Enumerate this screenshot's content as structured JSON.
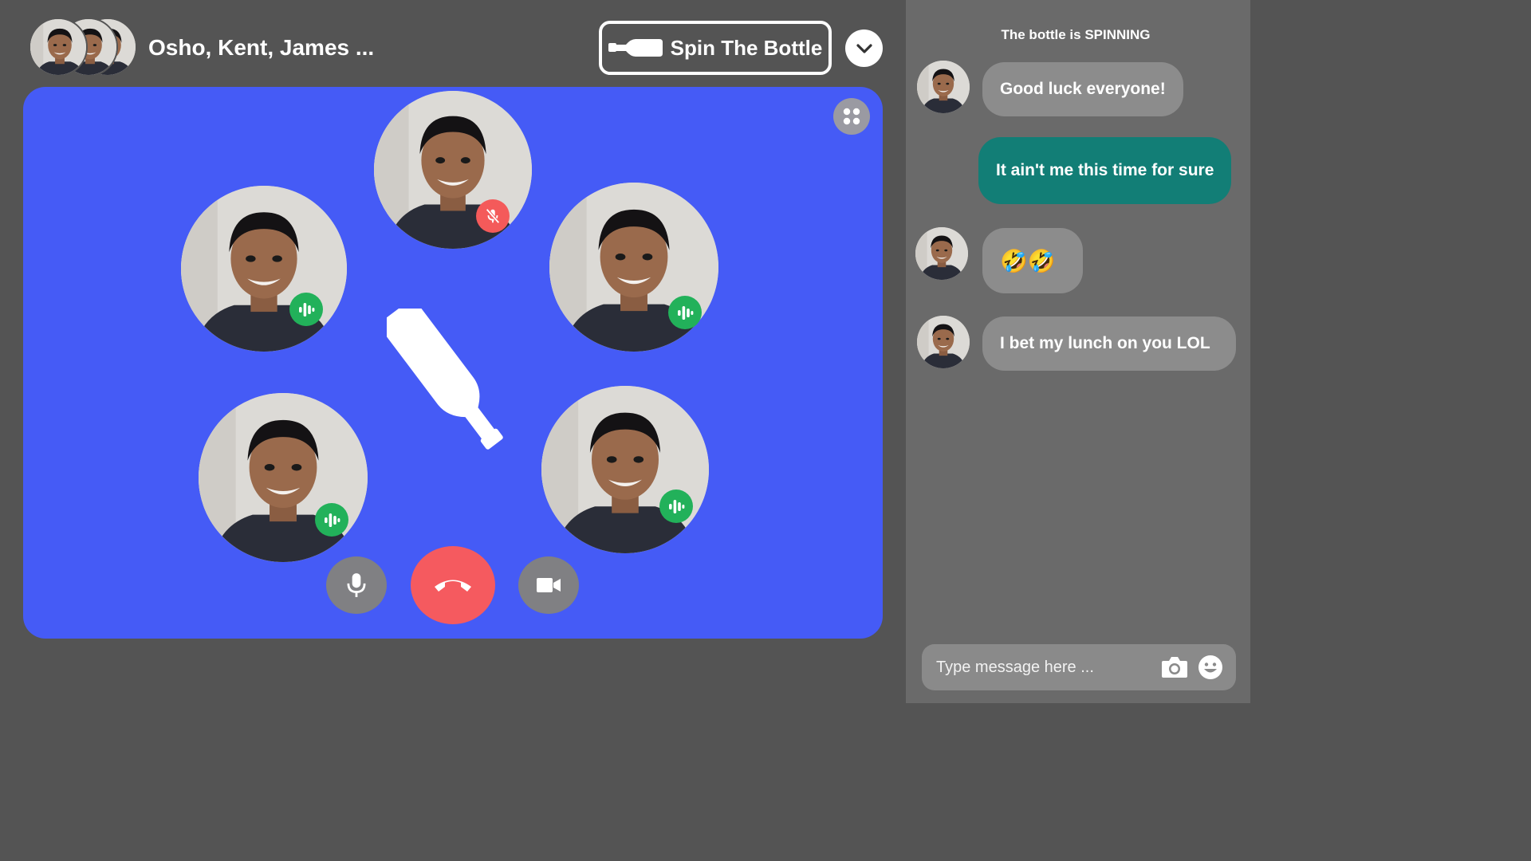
{
  "header": {
    "group_title": "Osho, Kent, James ...",
    "spin_button_label": "Spin The Bottle",
    "avatars": [
      "avatar",
      "avatar",
      "avatar"
    ]
  },
  "stage": {
    "background_color": "#455bf6",
    "participants": [
      {
        "status": "muted"
      },
      {
        "status": "talking"
      },
      {
        "status": "talking"
      },
      {
        "status": "talking"
      },
      {
        "status": "talking"
      }
    ],
    "controls": [
      "mic-icon",
      "end-call-icon",
      "video-camera-icon"
    ],
    "accent": {
      "talking": "#22b15a",
      "muted": "#f45a5a",
      "end_call": "#f55a5f"
    }
  },
  "chat": {
    "status": "The bottle is SPINNING",
    "messages": [
      {
        "text": "Good luck everyone!",
        "mine": false
      },
      {
        "text": "It ain't me this time for sure",
        "mine": true
      },
      {
        "text": "🤣🤣",
        "mine": false
      },
      {
        "text": "I bet my lunch on you LOL",
        "mine": false
      }
    ],
    "input_placeholder": "Type message here ...",
    "own_bubble_color": "#127e76"
  }
}
